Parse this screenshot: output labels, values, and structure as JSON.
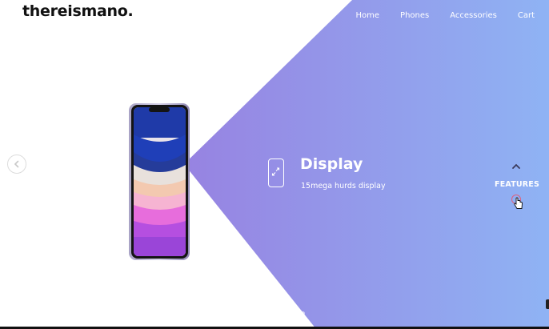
{
  "brand": {
    "logo": "thereismano."
  },
  "nav": {
    "items": [
      {
        "label": "Home"
      },
      {
        "label": "Phones"
      },
      {
        "label": "Accessories"
      },
      {
        "label": "Cart"
      }
    ]
  },
  "feature": {
    "title": "Display",
    "description": "15mega hurds display",
    "icon": "phone-expand-icon"
  },
  "side_nav": {
    "label": "FEATURES",
    "up_icon": "chevron-up-icon"
  },
  "carousel": {
    "prev_icon": "chevron-left-icon"
  },
  "colors": {
    "gradient_start": "#9b6ad8",
    "gradient_end": "#8fb3f4",
    "text_dark": "#111111",
    "accent_ring": "#e0607a"
  }
}
